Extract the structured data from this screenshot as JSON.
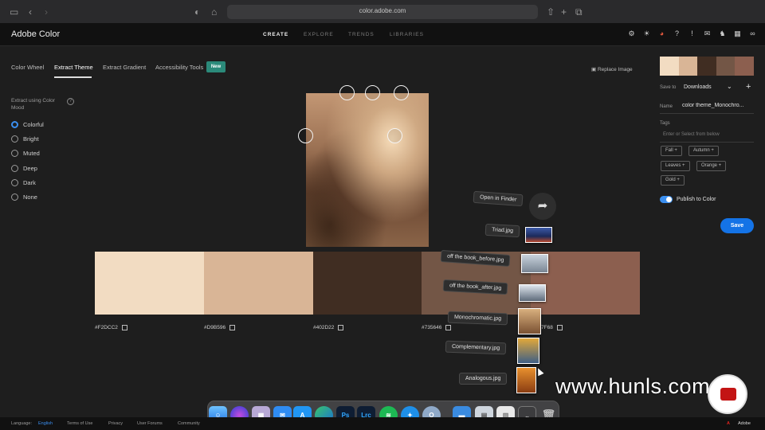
{
  "browser": {
    "url": "color.adobe.com"
  },
  "app": {
    "title": "Adobe Color",
    "nav": [
      "CREATE",
      "EXPLORE",
      "TRENDS",
      "LIBRARIES"
    ],
    "active_nav": "CREATE"
  },
  "tabs": {
    "color_wheel": "Color Wheel",
    "extract_theme": "Extract Theme",
    "extract_gradient": "Extract Gradient",
    "accessibility_tools": "Accessibility Tools",
    "new_badge": "New"
  },
  "replace_image": "Replace Image",
  "mood": {
    "title": "Extract using Color Mood",
    "options": [
      "Colorful",
      "Bright",
      "Muted",
      "Deep",
      "Dark",
      "None"
    ],
    "selected": "Colorful"
  },
  "swatches": [
    {
      "hex": "#F2DCC2",
      "color": "#F2DCC2"
    },
    {
      "hex": "#D9B596",
      "color": "#D9B596"
    },
    {
      "hex": "#402D22",
      "color": "#402D22"
    },
    {
      "hex": "#735646",
      "color": "#735646"
    },
    {
      "hex": "#8C5F4F",
      "label": "7F68",
      "color": "#8C5F4F"
    }
  ],
  "right_panel": {
    "save_to_label": "Save to",
    "save_to_value": "Downloads",
    "name_label": "Name",
    "name_value": "color theme_Monochro...",
    "tags_label": "Tags",
    "tags_placeholder": "Enter or Select from below",
    "tags": [
      "Fall",
      "Autumn",
      "Leaves",
      "Orange",
      "Gold"
    ],
    "publish_label": "Publish to Color",
    "save_button": "Save"
  },
  "drag_stack": {
    "open_in_finder": "Open in Finder",
    "files": [
      "Triad.jpg",
      "off the book_before.jpg",
      "off the book_after.jpg",
      "Monochromatic.jpg",
      "Complementary.jpg",
      "Analogous.jpg"
    ]
  },
  "watermark": "www.hunls.com",
  "dock": [
    "Ps",
    "Lrc"
  ],
  "footer": {
    "language_label": "Language:",
    "language_value": "English",
    "links": [
      "Terms of Use",
      "Privacy",
      "User Forums",
      "Community"
    ],
    "brand": "Adobe"
  }
}
